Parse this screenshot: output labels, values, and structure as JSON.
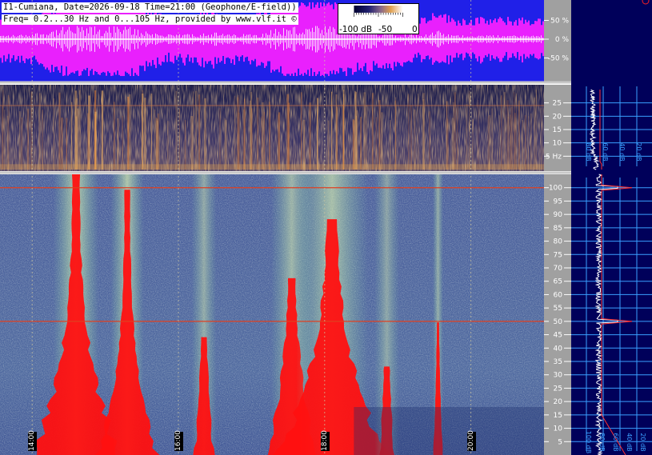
{
  "header": {
    "line1": "I1-Cumiana, Date=2026-09-18 Time=21:00 (Geophone/E-field))",
    "line2": "Freq= 0.2...30 Hz and 0...105 Hz, provided by www.vlf.it ©"
  },
  "colors": {
    "waveform_bg": "#2020e8",
    "waveform_magenta": "#ff20ff",
    "low_spectrogram_bg": "#2a2a55",
    "main_spectrogram_bg": "#4a5a9a",
    "main_red": "#ff1010",
    "side_panel_bg": "#00005a",
    "axis_panel_bg": "#a0a0a0",
    "side_grid": "#3aa0ff"
  },
  "chart_data": [
    {
      "type": "line",
      "name": "waveform-amplitude",
      "yunit": "%",
      "ylim": [
        -100,
        100
      ],
      "yticks": [
        {
          "value": 50,
          "label": "50 %"
        },
        {
          "value": 0,
          "label": "0 %"
        },
        {
          "value": -50,
          "label": "-50 %"
        }
      ]
    },
    {
      "type": "heatmap",
      "name": "geophone-spectrogram",
      "ylim": [
        0,
        30
      ],
      "yticks": [
        {
          "value": 25,
          "label": "25"
        },
        {
          "value": 20,
          "label": "20"
        },
        {
          "value": 15,
          "label": "15"
        },
        {
          "value": 10,
          "label": "10"
        },
        {
          "value": 5,
          "label": "5 Hz"
        }
      ],
      "colorbar": {
        "labels": [
          "-100 dB",
          "-50",
          "0"
        ],
        "range": [
          -100,
          0
        ]
      }
    },
    {
      "type": "heatmap",
      "name": "e-field-spectrogram",
      "ylim": [
        0,
        105
      ],
      "yticks": [
        {
          "value": 100,
          "label": "100"
        },
        {
          "value": 95,
          "label": "95"
        },
        {
          "value": 90,
          "label": "90"
        },
        {
          "value": 85,
          "label": "85"
        },
        {
          "value": 80,
          "label": "80"
        },
        {
          "value": 75,
          "label": "75"
        },
        {
          "value": 70,
          "label": "70"
        },
        {
          "value": 65,
          "label": "65"
        },
        {
          "value": 60,
          "label": "60"
        },
        {
          "value": 55,
          "label": "55"
        },
        {
          "value": 50,
          "label": "50"
        },
        {
          "value": 45,
          "label": "45"
        },
        {
          "value": 40,
          "label": "40"
        },
        {
          "value": 35,
          "label": "35"
        },
        {
          "value": 30,
          "label": "30"
        },
        {
          "value": 25,
          "label": "25"
        },
        {
          "value": 20,
          "label": "20"
        },
        {
          "value": 15,
          "label": "15"
        },
        {
          "value": 10,
          "label": "10"
        },
        {
          "value": 5,
          "label": "5"
        }
      ],
      "time_ticks": [
        {
          "hour": 14,
          "label": "14:00"
        },
        {
          "hour": 16,
          "label": "16:00"
        },
        {
          "hour": 18,
          "label": "18:00"
        },
        {
          "hour": 20,
          "label": "20:00"
        }
      ],
      "xlim": [
        13.56,
        21.0
      ],
      "hum_lines_hz": [
        50,
        100
      ],
      "bursts": [
        {
          "center_hour": 14.6,
          "width_hours": 0.22,
          "intensity": 1.0
        },
        {
          "center_hour": 15.3,
          "width_hours": 0.16,
          "intensity": 0.9
        },
        {
          "center_hour": 16.35,
          "width_hours": 0.12,
          "intensity": 0.4
        },
        {
          "center_hour": 17.55,
          "width_hours": 0.2,
          "intensity": 0.6
        },
        {
          "center_hour": 18.1,
          "width_hours": 0.35,
          "intensity": 0.8
        },
        {
          "center_hour": 18.85,
          "width_hours": 0.12,
          "intensity": 0.3
        },
        {
          "center_hour": 19.55,
          "width_hours": 0.05,
          "intensity": 0.45
        }
      ]
    },
    {
      "type": "line",
      "name": "geophone-spectrum-profile",
      "ylim": [
        0,
        30
      ],
      "xticks": [
        {
          "label": "80 dB"
        },
        {
          "label": "60 dB"
        },
        {
          "label": "40 dB"
        },
        {
          "label": "20 dB"
        }
      ]
    },
    {
      "type": "line",
      "name": "e-field-spectrum-profile",
      "ylim": [
        0,
        105
      ],
      "xticks": [
        {
          "label": "100 dB"
        },
        {
          "label": "80 dB"
        },
        {
          "label": "60 dB"
        },
        {
          "label": "40 dB"
        },
        {
          "label": "20 dB"
        }
      ],
      "peaks_hz": [
        50,
        100
      ]
    }
  ]
}
